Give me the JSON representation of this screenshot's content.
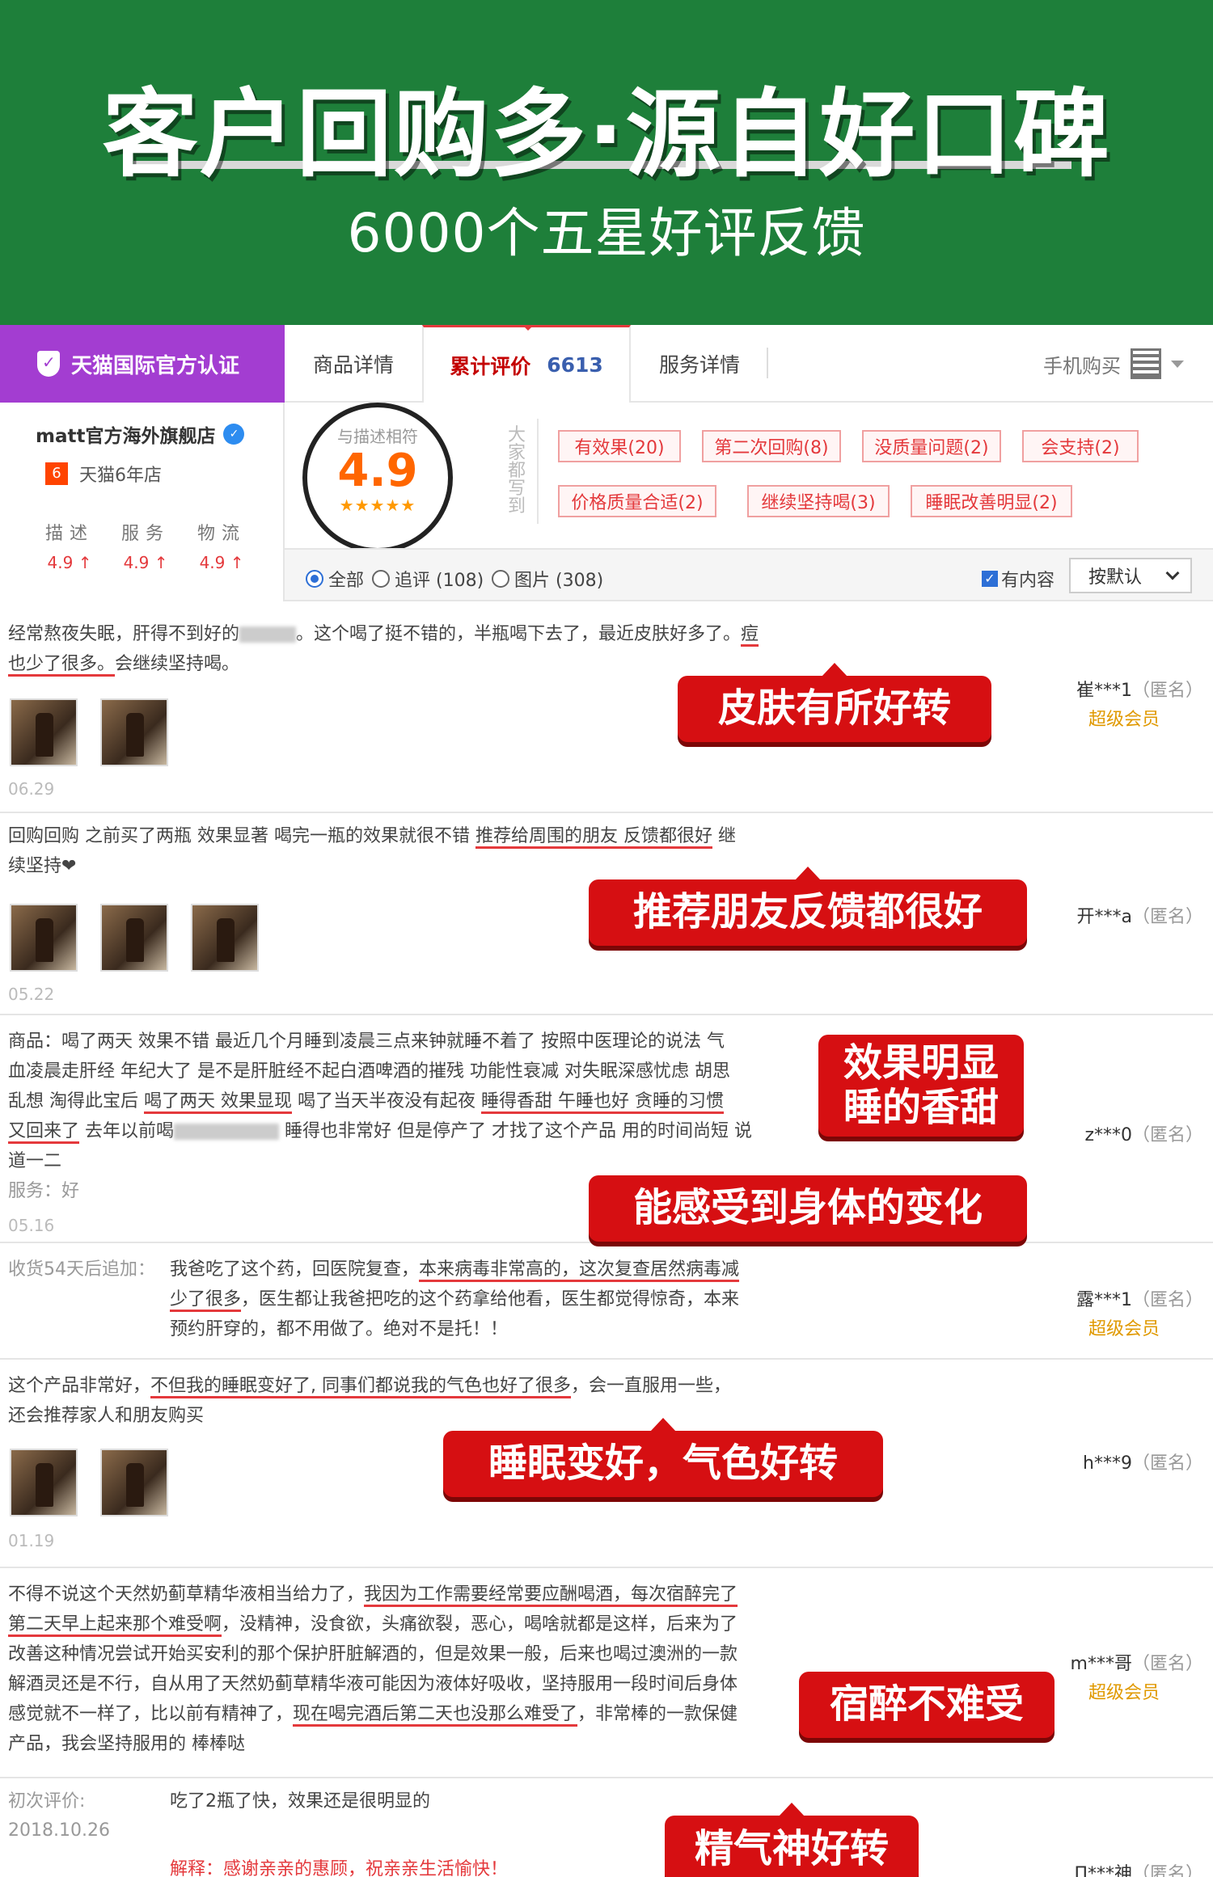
{
  "banner": {
    "title": "客户回购多·源自好口碑",
    "subtitle": "6000个五星好评反馈"
  },
  "tabs": {
    "tmall_badge": "天猫国际官方认证",
    "detail": "商品详情",
    "reviews_label": "累计评价",
    "reviews_count": "6613",
    "service": "服务详情",
    "mobile_buy": "手机购买"
  },
  "store": {
    "name": "matt官方海外旗舰店",
    "level": "6",
    "years": "天猫6年店",
    "dsr": [
      {
        "label": "描述",
        "value": "4.9 ↑"
      },
      {
        "label": "服务",
        "value": "4.9 ↑"
      },
      {
        "label": "物流",
        "value": "4.9 ↑"
      }
    ]
  },
  "rating": {
    "label": "与描述相符",
    "score": "4.9",
    "stars": "★★★★★",
    "tags_title": "大家都写到",
    "tags": [
      "有效果(20)",
      "第二次回购(8)",
      "没质量问题(2)",
      "会支持(2)",
      "价格质量合适(2)",
      "继续坚持喝(3)",
      "睡眠改善明显(2)"
    ]
  },
  "filter": {
    "all": "全部",
    "followup": "追评 (108)",
    "pictures": "图片 (308)",
    "has_content": "有内容",
    "sort": "按默认"
  },
  "reviews": [
    {
      "line1a": "经常熬夜失眠，肝得不到好的",
      "line1b": "。这个喝了挺不错的，半瓶喝下去了，最近皮肤好多了。",
      "line1c": "痘",
      "line2a": "也少了很多。",
      "line2b": "会继续坚持喝。",
      "date": "06.29",
      "user": "崔***1",
      "anon": "（匿名）",
      "vip": "超级会员",
      "callout": "皮肤有所好转"
    },
    {
      "line1a": "回购回购 之前买了两瓶 效果显著 喝完一瓶的效果就很不错 ",
      "line1b": "推荐给周围的朋友 反馈都很好",
      "line1c": " 继",
      "line2a": "续坚持❤",
      "date": "05.22",
      "user": "开***a",
      "anon": "（匿名）",
      "callout": "推荐朋友反馈都很好"
    },
    {
      "line1": "商品：喝了两天 效果不错 最近几个月睡到凌晨三点来钟就睡不着了 按照中医理论的说法 气",
      "line2": "血凌晨走肝经 年纪大了 是不是肝脏经不起白酒啤酒的摧残 功能性衰减 对失眠深感忧虑 胡思",
      "line3a": "乱想 淘得此宝后 ",
      "line3b": "喝了两天 效果显现",
      "line3c": " 喝了当天半夜没有起夜 ",
      "line3d": "睡得香甜 午睡也好 贪睡的习惯",
      "line4a": "又回来了",
      "line4b": " 去年以前喝",
      "line4c": " 睡得也非常好 但是停产了 才找了这个产品 用的时间尚短 说",
      "line5": "道一二",
      "service_label": "服务：好",
      "date": "05.16",
      "user": "z***0",
      "anon": "（匿名）",
      "callout_a": "效果明显\n睡的香甜",
      "callout_b": "能感受到身体的变化"
    },
    {
      "prefix": "收货54天后追加：",
      "line1a": "我爸吃了这个药，回医院复查，",
      "line1b": "本来病毒非常高的，这次复查居然病毒减",
      "line2a": "少了很多",
      "line2b": "，医生都让我爸把吃的这个药拿给他看，医生都觉得惊奇，本来",
      "line3": "预约肝穿的，都不用做了。绝对不是托！！",
      "user": "露***1",
      "anon": "（匿名）",
      "vip": "超级会员"
    },
    {
      "line1a": "这个产品非常好，",
      "line1b": "不但我的睡眠变好了, 同事们都说我的气色也好了很多",
      "line1c": "，会一直服用一些，",
      "line2": "还会推荐家人和朋友购买",
      "date": "01.19",
      "user": "h***9",
      "anon": "（匿名）",
      "callout": "睡眠变好，气色好转"
    },
    {
      "line1a": "不得不说这个天然奶蓟草精华液相当给力了，",
      "line1b": "我因为工作需要经常要应酬喝酒，每次宿醉完了",
      "line2a": "第二天早上起来那个难受啊",
      "line2b": "，没精神，没食欲，头痛欲裂，恶心，喝啥就都是这样，后来为了",
      "line3": "改善这种情况尝试开始买安利的那个保护肝脏解酒的，但是效果一般，后来也喝过澳洲的一款",
      "line4": "解酒灵还是不行，自从用了天然奶蓟草精华液可能因为液体好吸收，坚持服用一段时间后身体",
      "line5a": "感觉就不一样了，比以前有精神了，",
      "line5b": "现在喝完酒后第二天也没那么难受了",
      "line5c": "，非常棒的一款保健",
      "line6": "产品，我会坚持服用的 棒棒哒",
      "user": "m***哥",
      "anon": "（匿名）",
      "vip": "超级会员",
      "callout": "宿醉不难受"
    },
    {
      "label": "初次评价:",
      "date": "2018.10.26",
      "text": "吃了2瓶了快，效果还是很明显的",
      "reply": "解释：感谢亲亲的惠顾，祝亲亲生活愉快！",
      "user": "П***神",
      "anon": "（匿名）",
      "callout": "精气神好转"
    }
  ],
  "colors": {
    "banner_green": "#1e7f3a",
    "tmall_purple": "#a33dd1",
    "callout_red": "#d60f12",
    "score_orange": "#ff6600",
    "vip_gold": "#e09900"
  }
}
